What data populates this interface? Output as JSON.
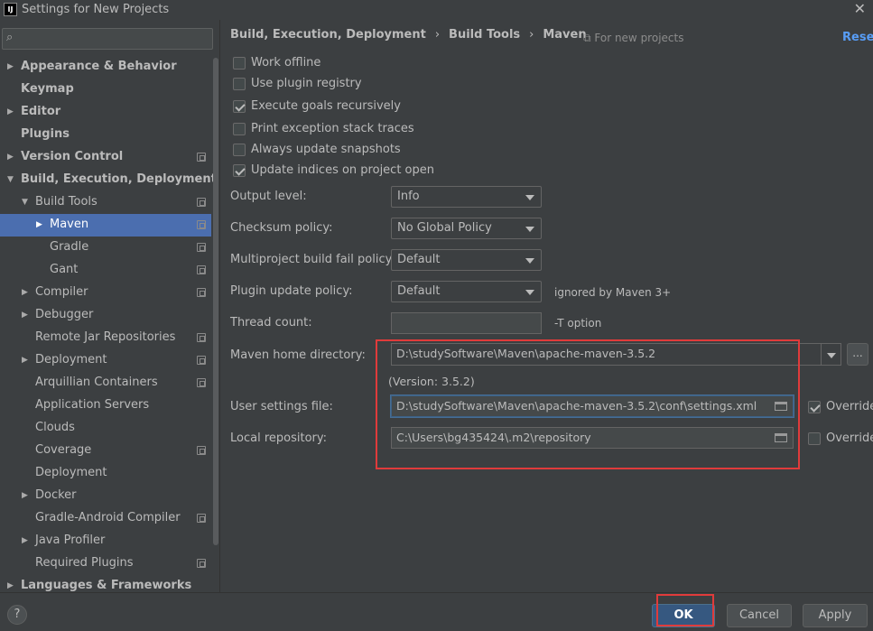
{
  "window": {
    "app_icon_text": "IJ",
    "title": "Settings for New Projects",
    "close_glyph": "✕"
  },
  "search": {
    "placeholder": "",
    "icon": "search-icon"
  },
  "sidebar": {
    "items": [
      {
        "label": "Appearance & Behavior",
        "arrow": "▶",
        "bold": true
      },
      {
        "label": "Keymap",
        "arrow": "",
        "bold": true
      },
      {
        "label": "Editor",
        "arrow": "▶",
        "bold": true
      },
      {
        "label": "Plugins",
        "arrow": "",
        "bold": true
      },
      {
        "label": "Version Control",
        "arrow": "▶",
        "bold": true
      },
      {
        "label": "Build, Execution, Deployment",
        "arrow": "▼",
        "bold": true
      },
      {
        "label": "Build Tools",
        "arrow": "▼"
      },
      {
        "label": "Maven",
        "arrow": "▶",
        "selected": true
      },
      {
        "label": "Gradle",
        "arrow": ""
      },
      {
        "label": "Gant",
        "arrow": ""
      },
      {
        "label": "Compiler",
        "arrow": "▶"
      },
      {
        "label": "Debugger",
        "arrow": "▶"
      },
      {
        "label": "Remote Jar Repositories",
        "arrow": ""
      },
      {
        "label": "Deployment",
        "arrow": "▶"
      },
      {
        "label": "Arquillian Containers",
        "arrow": ""
      },
      {
        "label": "Application Servers",
        "arrow": ""
      },
      {
        "label": "Clouds",
        "arrow": ""
      },
      {
        "label": "Coverage",
        "arrow": ""
      },
      {
        "label": "Deployment",
        "arrow": ""
      },
      {
        "label": "Docker",
        "arrow": "▶"
      },
      {
        "label": "Gradle-Android Compiler",
        "arrow": ""
      },
      {
        "label": "Java Profiler",
        "arrow": "▶"
      },
      {
        "label": "Required Plugins",
        "arrow": ""
      },
      {
        "label": "Languages & Frameworks",
        "arrow": "▶",
        "bold": true
      }
    ]
  },
  "header": {
    "crumb1": "Build, Execution, Deployment",
    "crumb2": "Build Tools",
    "crumb3": "Maven",
    "sep": "›",
    "scope": "⧉ For new projects",
    "reset": "Reset"
  },
  "options": {
    "work_offline": {
      "label": "Work offline",
      "checked": false
    },
    "use_plugin_registry": {
      "label": "Use plugin registry",
      "checked": false
    },
    "execute_goals_recursively": {
      "label": "Execute goals recursively",
      "checked": true
    },
    "print_exception_stack_traces": {
      "label": "Print exception stack traces",
      "checked": false
    },
    "always_update_snapshots": {
      "label": "Always update snapshots",
      "checked": false
    },
    "update_indices_on_project_open": {
      "label": "Update indices on project open",
      "checked": true
    }
  },
  "form": {
    "output_level": {
      "label": "Output level:",
      "value": "Info"
    },
    "checksum_policy": {
      "label": "Checksum policy:",
      "value": "No Global Policy"
    },
    "multiproject_fail_policy": {
      "label": "Multiproject build fail policy:",
      "value": "Default"
    },
    "plugin_update_policy": {
      "label": "Plugin update policy:",
      "value": "Default",
      "hint": "ignored by Maven 3+"
    },
    "thread_count": {
      "label": "Thread count:",
      "value": "",
      "hint": "-T option"
    },
    "maven_home": {
      "label": "Maven home directory:",
      "value": "D:\\studySoftware\\Maven\\apache-maven-3.5.2",
      "version": "(Version: 3.5.2)",
      "browse": "..."
    },
    "user_settings": {
      "label": "User settings file:",
      "value": "D:\\studySoftware\\Maven\\apache-maven-3.5.2\\conf\\settings.xml",
      "override_label": "Override",
      "override_checked": true
    },
    "local_repository": {
      "label": "Local repository:",
      "value": "C:\\Users\\bg435424\\.m2\\repository",
      "override_label": "Override",
      "override_checked": false
    }
  },
  "footer": {
    "help": "?",
    "ok": "OK",
    "cancel": "Cancel",
    "apply": "Apply"
  },
  "colors": {
    "background": "#3c3f41",
    "selection": "#4b6eaf",
    "link": "#589df6",
    "highlight_box": "#e03b3b",
    "default_button": "#365880"
  }
}
